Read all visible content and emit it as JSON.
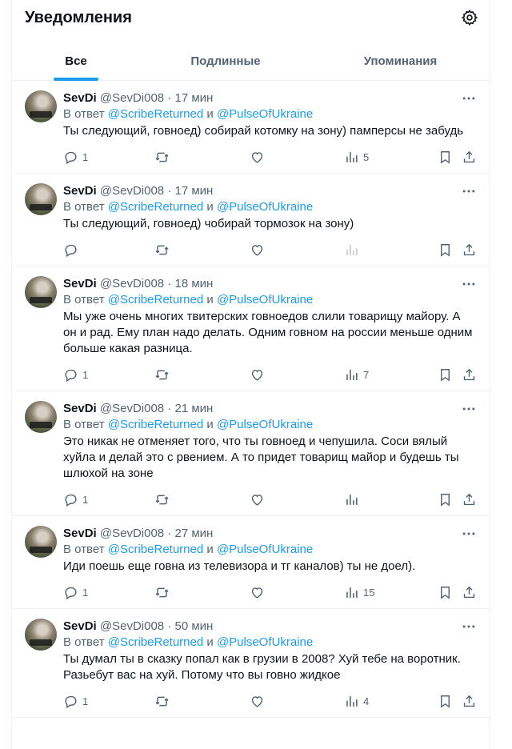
{
  "header": {
    "title": "Уведомления"
  },
  "tabs": [
    {
      "label": "Все",
      "active": true
    },
    {
      "label": "Подлинные",
      "active": false
    },
    {
      "label": "Упоминания",
      "active": false
    }
  ],
  "colors": {
    "accent": "#1d9bf0",
    "muted": "#536471",
    "text": "#0f1419"
  },
  "tweets": [
    {
      "name": "SevDi",
      "handle": "@SevDi008",
      "time": "· 17 мин",
      "reply_prefix": "В ответ",
      "mention1": "@ScribeReturned",
      "conj": "и",
      "mention2": "@PulseOfUkraine",
      "text": "Ты следующий, говноед) собирай котомку на зону) памперсы не забудь",
      "replies": "1",
      "retweets": "",
      "likes": "",
      "views": "5"
    },
    {
      "name": "SevDi",
      "handle": "@SevDi008",
      "time": "· 17 мин",
      "reply_prefix": "В ответ",
      "mention1": "@ScribeReturned",
      "conj": "и",
      "mention2": "@PulseOfUkraine",
      "text": "Ты следующий, говноед) чобирай тормозок на зону)",
      "replies": "",
      "retweets": "",
      "likes": "",
      "views": ""
    },
    {
      "name": "SevDi",
      "handle": "@SevDi008",
      "time": "· 18 мин",
      "reply_prefix": "В ответ",
      "mention1": "@ScribeReturned",
      "conj": "и",
      "mention2": "@PulseOfUkraine",
      "text": "Мы уже очень многих твитерских говноедов слили товарищу майору. А он и рад. Ему план надо делать. Одним говном на россии меньше одним больше какая разница.",
      "replies": "1",
      "retweets": "",
      "likes": "",
      "views": "7"
    },
    {
      "name": "SevDi",
      "handle": "@SevDi008",
      "time": "· 21 мин",
      "reply_prefix": "В ответ",
      "mention1": "@ScribeReturned",
      "conj": "и",
      "mention2": "@PulseOfUkraine",
      "text": "Это никак не отменяет того, что ты говноед и чепушила. Соси вялый хуйла и делай это с рвением. А то придет товарищ майор и будешь ты шлюхой на зоне",
      "replies": "1",
      "retweets": "",
      "likes": "",
      "views": ""
    },
    {
      "name": "SevDi",
      "handle": "@SevDi008",
      "time": "· 27 мин",
      "reply_prefix": "В ответ",
      "mention1": "@ScribeReturned",
      "conj": "и",
      "mention2": "@PulseOfUkraine",
      "text": "Иди поешь еще говна из телевизора и тг каналов) ты не доел).",
      "replies": "1",
      "retweets": "",
      "likes": "",
      "views": "15"
    },
    {
      "name": "SevDi",
      "handle": "@SevDi008",
      "time": "· 50 мин",
      "reply_prefix": "В ответ",
      "mention1": "@ScribeReturned",
      "conj": "и",
      "mention2": "@PulseOfUkraine",
      "text": "Ты думал ты в сказку попал как в грузии в 2008? Хуй тебе на воротник. Разьебут вас на хуй. Потому что вы говно жидкое",
      "replies": "1",
      "retweets": "",
      "likes": "",
      "views": "4"
    }
  ]
}
